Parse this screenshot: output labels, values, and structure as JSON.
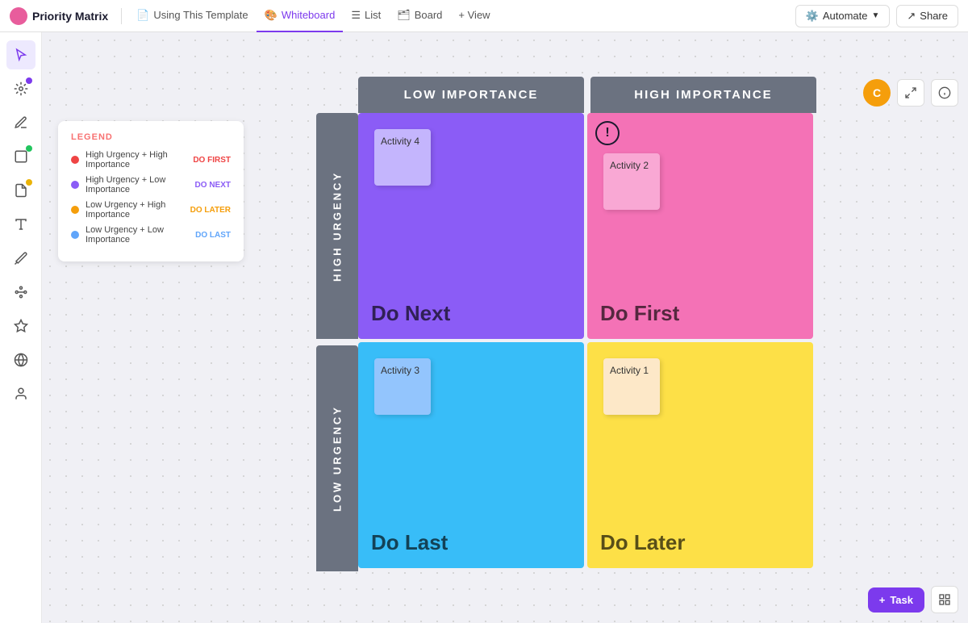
{
  "app": {
    "logo_bg": "#e85d9c",
    "title": "Priority Matrix"
  },
  "nav": {
    "tabs": [
      {
        "id": "using-template",
        "label": "Using This Template",
        "icon": "📄",
        "active": false
      },
      {
        "id": "whiteboard",
        "label": "Whiteboard",
        "icon": "🎨",
        "active": true
      },
      {
        "id": "list",
        "label": "List",
        "icon": "☰",
        "active": false
      },
      {
        "id": "board",
        "label": "Board",
        "icon": "🗂",
        "active": false
      },
      {
        "id": "view",
        "label": "+ View",
        "icon": "",
        "active": false
      }
    ],
    "automate_label": "Automate",
    "share_label": "Share"
  },
  "legend": {
    "title": "LEGEND",
    "items": [
      {
        "color": "#ef4444",
        "label": "High Urgency + High Importance",
        "badge": "DO FIRST",
        "badge_class": "badge-first"
      },
      {
        "color": "#8b5cf6",
        "label": "High Urgency + Low Importance",
        "badge": "DO NEXT",
        "badge_class": "badge-next"
      },
      {
        "color": "#f59e0b",
        "label": "Low Urgency + High Importance",
        "badge": "DO LATER",
        "badge_class": "badge-later"
      },
      {
        "color": "#60a5fa",
        "label": "Low Urgency + Low Importance",
        "badge": "DO LAST",
        "badge_class": "badge-last"
      }
    ]
  },
  "matrix": {
    "col_header_low": "LOW IMPORTANCE",
    "col_header_high": "HIGH IMPORTANCE",
    "row_header_high": "HIGH URGENCY",
    "row_header_low": "LOW URGENCY",
    "quadrants": [
      {
        "id": "q-top-left",
        "color": "q-purple",
        "label": "Do Next",
        "activity": "Activity 4"
      },
      {
        "id": "q-top-right",
        "color": "q-pink",
        "label": "Do First",
        "activity": "Activity 2"
      },
      {
        "id": "q-bottom-left",
        "color": "q-blue",
        "label": "Do Last",
        "activity": "Activity 3"
      },
      {
        "id": "q-bottom-right",
        "color": "q-yellow",
        "label": "Do Later",
        "activity": "Activity 1"
      }
    ]
  },
  "avatar": {
    "initials": "C",
    "bg": "#f59e0b"
  },
  "task_button": {
    "label": "Task",
    "plus": "+"
  }
}
